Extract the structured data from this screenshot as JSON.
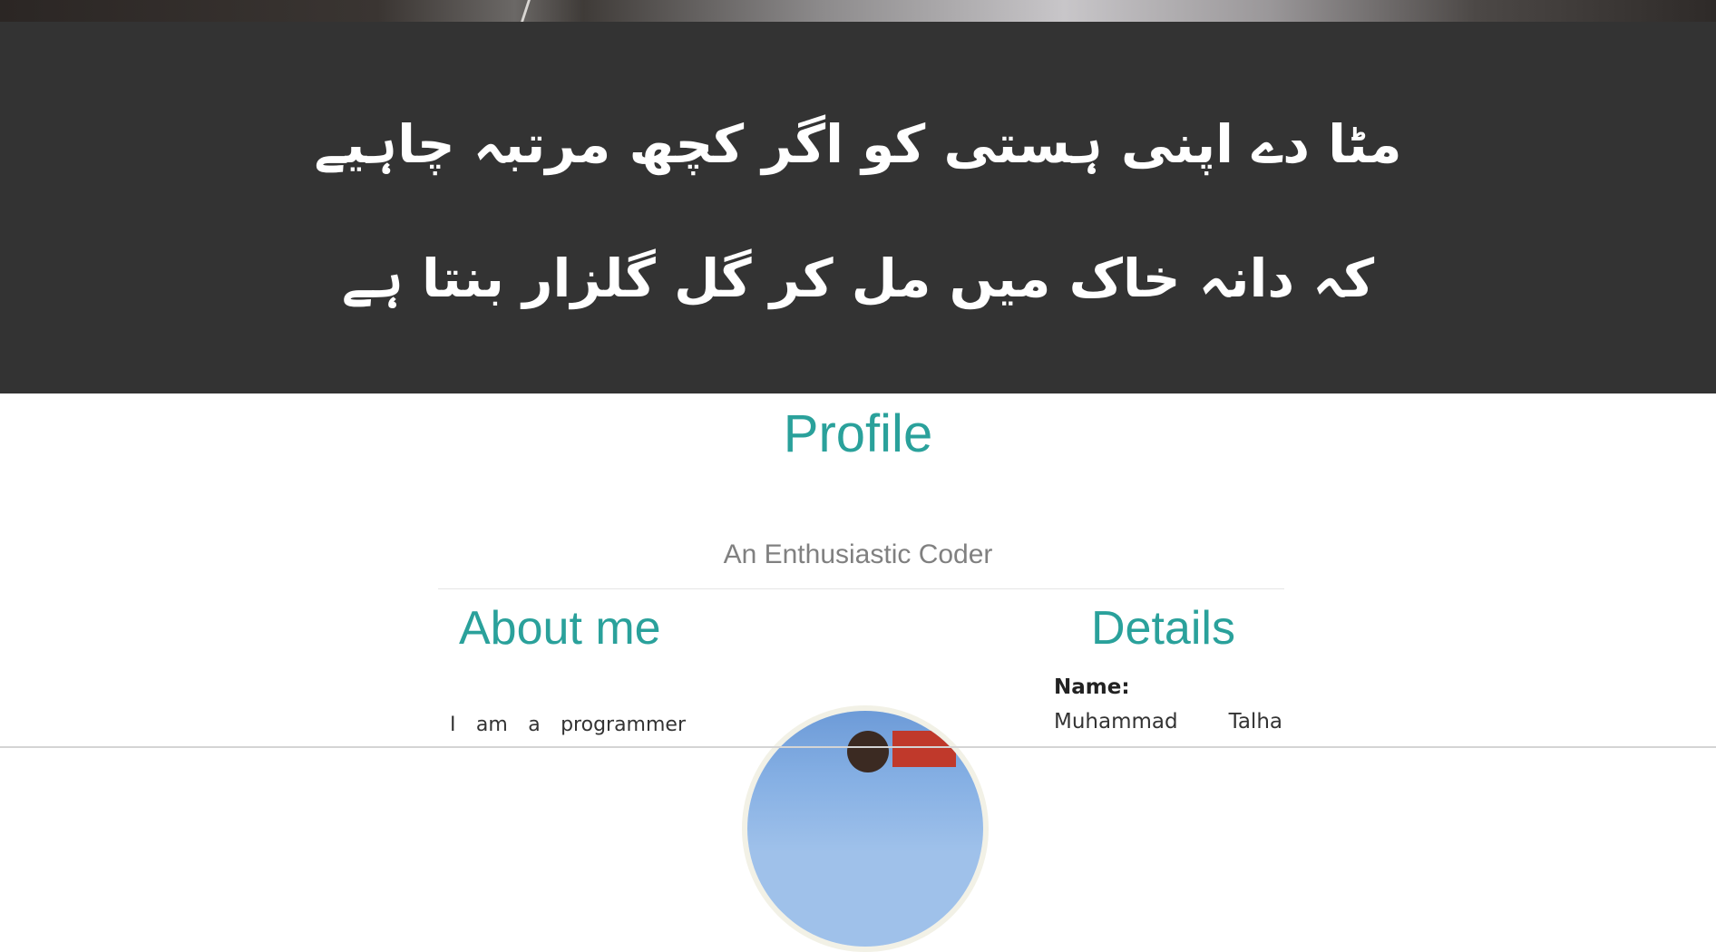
{
  "hero": {
    "poem_line_1": "مٹا دے اپنی ہستی کو اگر کچھ مرتبہ چاہیے",
    "poem_line_2": "کہ دانہ خاک میں مل کر گل گلزار بنتا ہے"
  },
  "profile": {
    "title": "Profile",
    "tagline": "An Enthusiastic Coder"
  },
  "about": {
    "heading": "About me",
    "text": "I am a programmer"
  },
  "details": {
    "heading": "Details",
    "name_label": "Name:",
    "name_value": "Muhammad Talha"
  },
  "colors": {
    "accent": "#2aa19b",
    "hero_bg": "#333333",
    "tagline": "#808080"
  },
  "icons": {
    "photo": "profile-photo"
  }
}
